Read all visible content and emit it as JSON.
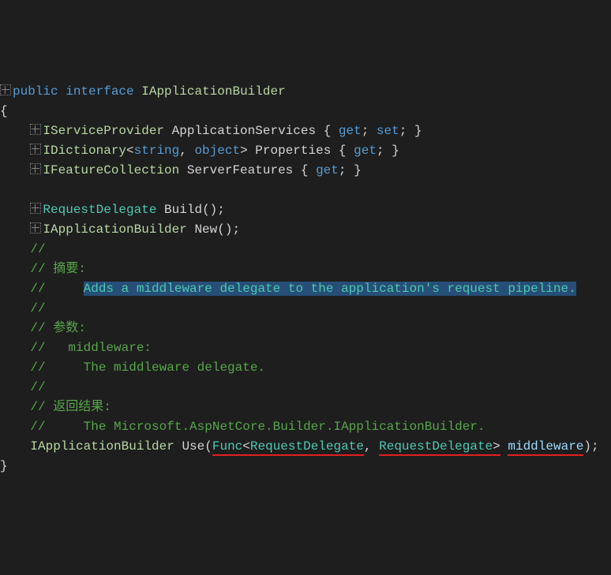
{
  "line1": {
    "kw1": "public",
    "kw2": "interface",
    "name": "IApplicationBuilder"
  },
  "brace_open": "{",
  "prop1": {
    "type": "IServiceProvider",
    "name": "ApplicationServices",
    "get": "get",
    "set": "set"
  },
  "prop2": {
    "type_a": "IDictionary",
    "lt": "<",
    "arg1": "string",
    "comma": ", ",
    "arg2": "object",
    "gt": ">",
    "name": "Properties",
    "get": "get"
  },
  "prop3": {
    "type": "IFeatureCollection",
    "name": "ServerFeatures",
    "get": "get"
  },
  "m1": {
    "ret": "RequestDelegate",
    "name": "Build",
    "parens": "();"
  },
  "m2": {
    "ret": "IApplicationBuilder",
    "name": "New",
    "parens": "();"
  },
  "c_slash": "//",
  "c_summary_hdr": "// 摘要:",
  "c_summary_txt": "Adds a middleware delegate to the application's request pipeline.",
  "c_params_hdr": "// 参数:",
  "c_param_name": "//   middleware:",
  "c_param_desc": "//     The middleware delegate.",
  "c_ret_hdr": "// 返回结果:",
  "c_ret_desc": "//     The Microsoft.AspNetCore.Builder.IApplicationBuilder.",
  "use": {
    "ret": "IApplicationBuilder",
    "name": "Use",
    "open": "(",
    "func": "Func",
    "lt": "<",
    "arg1": "RequestDelegate",
    "comma": ", ",
    "arg2": "RequestDelegate",
    "gt": ">",
    "param": "middleware",
    "close": ");"
  },
  "brace_close": "}"
}
